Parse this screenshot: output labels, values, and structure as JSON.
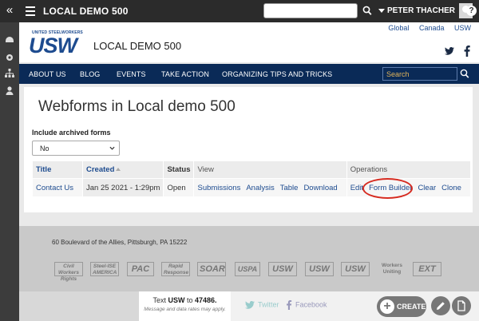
{
  "topbar": {
    "site_name": "LOCAL DEMO 500",
    "search_value": "",
    "user_name": "PETER THACHER",
    "help_label": "?"
  },
  "header": {
    "logo_small": "UNITED STEELWORKERS",
    "logo_big": "USW",
    "local_title": "LOCAL DEMO 500",
    "geo_links": [
      "Global",
      "Canada",
      "USW"
    ]
  },
  "nav": {
    "items": [
      "ABOUT US",
      "BLOG",
      "EVENTS",
      "TAKE ACTION",
      "ORGANIZING TIPS AND TRICKS"
    ],
    "search_placeholder": "Search"
  },
  "main": {
    "page_title": "Webforms in Local demo 500",
    "archived_label": "Include archived forms",
    "archived_value": "No",
    "table": {
      "headers": [
        "Title",
        "Created",
        "Status",
        "View",
        "Operations"
      ],
      "rows": [
        {
          "title": "Contact Us",
          "created": "Jan 25 2021 - 1:29pm",
          "status": "Open",
          "view": [
            "Submissions",
            "Analysis",
            "Table",
            "Download"
          ],
          "operations": [
            "Edit",
            "Form Builder",
            "Clear",
            "Clone"
          ]
        }
      ]
    }
  },
  "footer": {
    "address": "60 Boulevard of the Allies, Pittsburgh, PA 15222",
    "affiliates": [
      "Civil Workers Rights",
      "Steel-ISE AMERICA",
      "PAC",
      "Rapid Response",
      "SOAR",
      "USPA",
      "USW",
      "USW",
      "USW",
      "Workers Uniting",
      "EXT"
    ]
  },
  "bottom": {
    "sms_prefix": "Text ",
    "sms_keyword": "USW",
    "sms_middle": " to ",
    "sms_number": "47486.",
    "sms_disclaimer": "Message and data rates may apply.",
    "twitter_label": "Twitter",
    "facebook_label": "Facebook",
    "create_label": "CREATE"
  }
}
